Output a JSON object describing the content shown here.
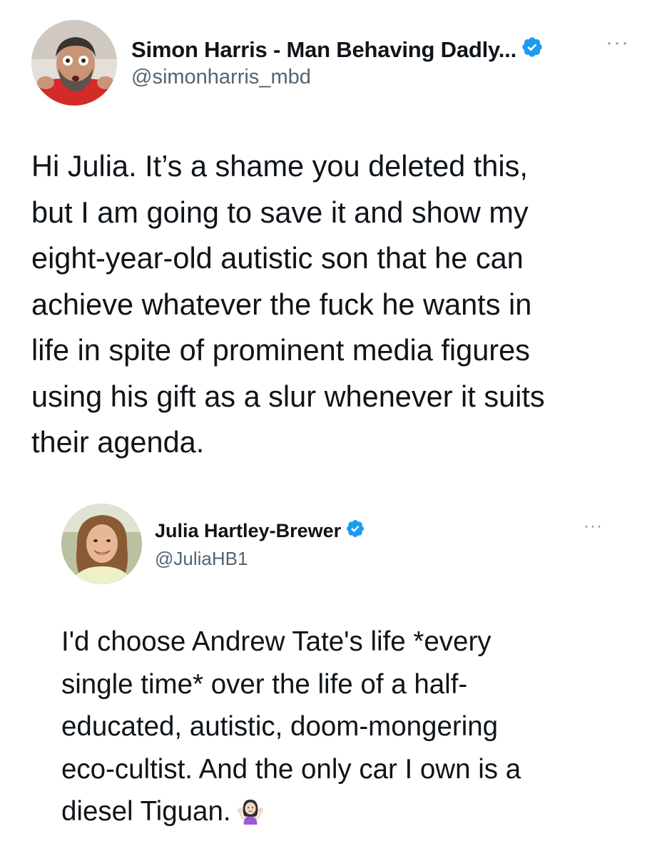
{
  "main_tweet": {
    "display_name": "Simon Harris - Man Behaving Dadly...",
    "handle": "@simonharris_mbd",
    "more_label": "···",
    "text": "Hi Julia. It’s a shame you deleted this,\nbut I am going to save it and show my\neight-year-old autistic son that he can\nachieve whatever the fuck he wants in\nlife in spite of prominent media figures\nusing his gift as a slur whenever it suits\ntheir agenda."
  },
  "quoted_tweet": {
    "display_name": "Julia Hartley-Brewer",
    "handle": "@JuliaHB1",
    "more_label": "···",
    "text": "I'd choose Andrew Tate's life *every\nsingle time* over the life of a half-\neducated, autistic, doom-mongering\neco-cultist. And the only car I own is a\ndiesel Tiguan.",
    "emoji": "woman-shrugging-icon"
  },
  "colors": {
    "verified_blue": "#1d9bf0",
    "text_primary": "#0f1419",
    "text_secondary": "#536471",
    "background": "#ffffff"
  }
}
